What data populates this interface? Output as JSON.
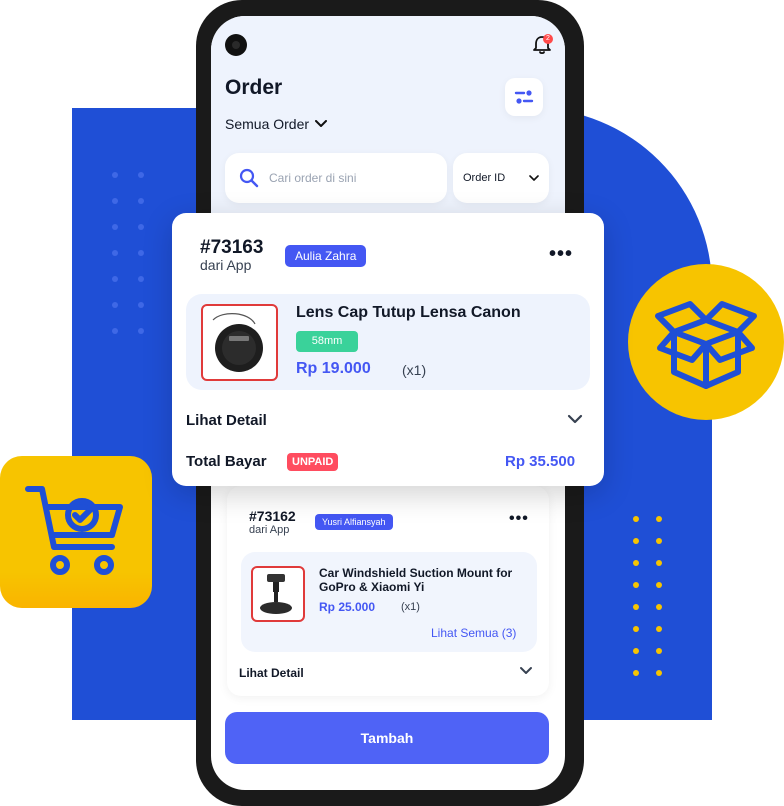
{
  "colors": {
    "accent_blue": "#4457f3",
    "background_blue": "#1f4fd6",
    "yellow": "#f7c400",
    "unpaid_red": "#ff4c5f",
    "size_green": "#3ad29a"
  },
  "status_bar": {
    "notification_count": "2"
  },
  "header": {
    "title": "Order",
    "filter_label": "Semua Order"
  },
  "search": {
    "placeholder": "Cari order di sini",
    "select_value": "Order ID"
  },
  "orders": [
    {
      "id": "#73163",
      "source": "dari App",
      "customer": "Aulia Zahra",
      "product": {
        "name": "Lens Cap Tutup Lensa Canon",
        "variant": "58mm",
        "price": "Rp 19.000",
        "qty": "(x1)"
      },
      "detail_label": "Lihat Detail",
      "total_label": "Total Bayar",
      "status": "UNPAID",
      "total_amount": "Rp 35.500"
    },
    {
      "id": "#73162",
      "source": "dari App",
      "customer": "Yusri Alfiansyah",
      "product": {
        "name": "Car Windshield Suction Mount for GoPro & Xiaomi Yi",
        "price": "Rp 25.000",
        "qty": "(x1)"
      },
      "see_all": "Lihat Semua (3)",
      "detail_label": "Lihat Detail"
    }
  ],
  "actions": {
    "add_label": "Tambah"
  },
  "icons": {
    "bell": "bell-icon",
    "filter": "filter-icon",
    "search": "search-icon",
    "chevron": "chevron-down-icon",
    "more": "more-icon",
    "box": "box-icon",
    "cart": "cart-check-icon"
  }
}
